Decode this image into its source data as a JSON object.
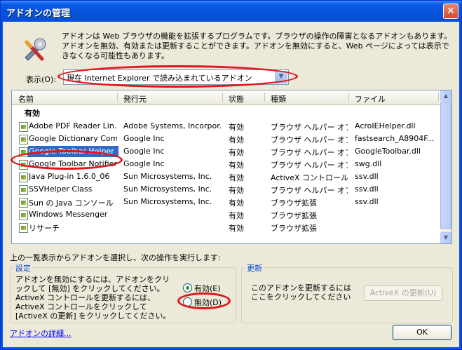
{
  "window": {
    "title": "アドオンの管理",
    "close": "✕"
  },
  "description": "アドオンは Web ブラウザの機能を拡張するプログラムです。ブラウザの操作の障害となるアドオンもあります。アドオンを無効、有効または更新することができます。アドオンを無効にすると、Web ページによっては表示できなくなる可能性もあります。",
  "show": {
    "label": "表示(O):",
    "value": "現在 Internet Explorer で読み込まれているアドオン"
  },
  "list": {
    "columns": [
      "名前",
      "発行元",
      "状態",
      "種類",
      "ファイル"
    ],
    "group": "有効",
    "rows": [
      {
        "name": "Adobe PDF Reader Lin...",
        "publisher": "Adobe Systems, Incorpor...",
        "status": "有効",
        "type": "ブラウザ ヘルパー オブ...",
        "file": "AcroIEHelper.dll"
      },
      {
        "name": "Google Dictionary Com...",
        "publisher": "Google Inc",
        "status": "有効",
        "type": "ブラウザ ヘルパー オブ...",
        "file": "fastsearch_A8904F..."
      },
      {
        "name": "Google Toolbar Helper",
        "publisher": "Google Inc",
        "status": "有効",
        "type": "ブラウザ ヘルパー オブ...",
        "file": "GoogleToolbar.dll"
      },
      {
        "name": "Google Toolbar Notifier...",
        "publisher": "Google Inc",
        "status": "有効",
        "type": "ブラウザ ヘルパー オブ...",
        "file": "swg.dll"
      },
      {
        "name": "Java Plug-in 1.6.0_06",
        "publisher": "Sun Microsystems, Inc.",
        "status": "有効",
        "type": "ActiveX コントロール",
        "file": "ssv.dll"
      },
      {
        "name": "SSVHelper Class",
        "publisher": "Sun Microsystems, Inc.",
        "status": "有効",
        "type": "ブラウザ ヘルパー オブ...",
        "file": "ssv.dll"
      },
      {
        "name": "Sun の Java コンソール",
        "publisher": "Sun Microsystems, Inc.",
        "status": "有効",
        "type": "ブラウザ拡張",
        "file": "ssv.dll"
      },
      {
        "name": "Windows Messenger",
        "publisher": "",
        "status": "有効",
        "type": "ブラウザ拡張",
        "file": ""
      },
      {
        "name": "リサーチ",
        "publisher": "",
        "status": "有効",
        "type": "ブラウザ拡張",
        "file": ""
      }
    ]
  },
  "instruction": "上の一覧表示からアドオンを選択し、次の操作を実行します:",
  "settings": {
    "title": "設定",
    "text": "アドオンを無効にするには、アドオンをクリックして [無効] をクリックしてください。ActiveX コントロールを更新するには、ActiveX コントロールをクリックして [ActiveX の更新] をクリックしてください。",
    "enable": "有効(E)",
    "disable": "無効(D)"
  },
  "update": {
    "title": "更新",
    "text": "このアドオンを更新するにはここをクリックしてください",
    "button": "ActiveX の更新(U)"
  },
  "details_link": "アドオンの詳細...",
  "ok": "OK"
}
